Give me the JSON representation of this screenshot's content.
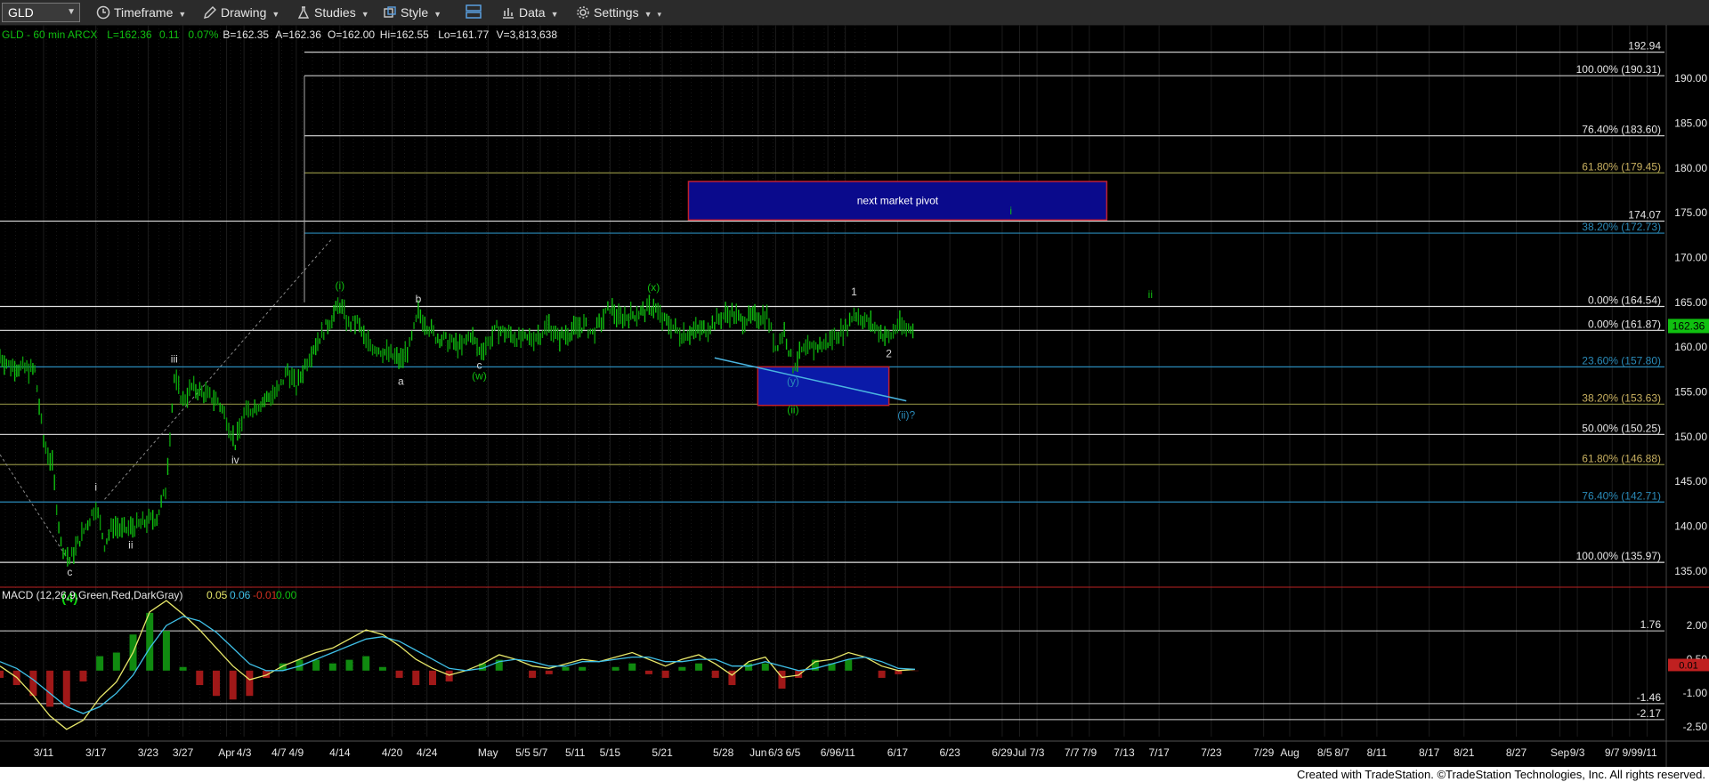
{
  "toolbar": {
    "symbol": "GLD",
    "timeframe": "Timeframe",
    "drawing": "Drawing",
    "studies": "Studies",
    "style": "Style",
    "data": "Data",
    "settings": "Settings"
  },
  "footer": "Created with TradeStation. ©TradeStation Technologies, Inc. All rights reserved.",
  "colors": {
    "bg": "#000000",
    "up": "#00c000",
    "down": "#c00000",
    "accent": "#2a8ab8",
    "pivot_box": "#0a0a8c"
  },
  "chart_data": [
    {
      "type": "line",
      "series_name": "GLD - 60 min ARCX",
      "header": {
        "symbol_line": "GLD - 60 min ARCX",
        "last": "L=162.36",
        "change": "0.11",
        "pct": "0.07%",
        "bid": "B=162.35",
        "ask": "A=162.36",
        "open": "O=162.00",
        "high": "Hi=162.55",
        "low": "Lo=161.77",
        "volume": "V=3,813,638"
      },
      "x_tick_labels": [
        "3/11",
        "3/17",
        "3/23",
        "3/27",
        "Apr",
        "4/3",
        "4/7",
        "4/9",
        "4/14",
        "4/20",
        "4/24",
        "May",
        "5/5",
        "5/7",
        "5/11",
        "5/15",
        "5/21",
        "5/28",
        "Jun",
        "6/3",
        "6/5",
        "6/9",
        "6/11",
        "6/17",
        "6/23",
        "6/29",
        "Jul",
        "7/3",
        "7/7",
        "7/9",
        "7/13",
        "7/17",
        "7/23",
        "7/29",
        "Aug",
        "8/5",
        "8/7",
        "8/11",
        "8/17",
        "8/21",
        "8/27",
        "Sep",
        "9/3",
        "9/7",
        "9/9",
        "9/11"
      ],
      "ylim": [
        133,
        193
      ],
      "y_ticks": [
        "135.00",
        "140.00",
        "145.00",
        "150.00",
        "155.00",
        "160.00",
        "165.00",
        "170.00",
        "175.00",
        "180.00",
        "185.00",
        "190.00"
      ],
      "last_price": "162.36",
      "price_points": [
        [
          "2025-03-06",
          159.0
        ],
        [
          "2025-03-07",
          158.0
        ],
        [
          "2025-03-10",
          157.4
        ],
        [
          "2025-03-11",
          149.5
        ],
        [
          "2025-03-12",
          146.8
        ],
        [
          "2025-03-13",
          138.0
        ],
        [
          "2025-03-14",
          136.2
        ],
        [
          "2025-03-17",
          142.3
        ],
        [
          "2025-03-18",
          138.0
        ],
        [
          "2025-03-19",
          140.2
        ],
        [
          "2025-03-20",
          139.5
        ],
        [
          "2025-03-21",
          139.8
        ],
        [
          "2025-03-24",
          141.0
        ],
        [
          "2025-03-25",
          144.0
        ],
        [
          "2025-03-26",
          156.5
        ],
        [
          "2025-03-27",
          154.0
        ],
        [
          "2025-03-28",
          155.5
        ],
        [
          "2025-03-31",
          154.0
        ],
        [
          "2025-04-01",
          152.0
        ],
        [
          "2025-04-02",
          149.2
        ],
        [
          "2025-04-03",
          152.5
        ],
        [
          "2025-04-04",
          153.2
        ],
        [
          "2025-04-07",
          155.2
        ],
        [
          "2025-04-08",
          157.5
        ],
        [
          "2025-04-09",
          155.5
        ],
        [
          "2025-04-10",
          158.0
        ],
        [
          "2025-04-11",
          160.0
        ],
        [
          "2025-04-14",
          164.8
        ],
        [
          "2025-04-15",
          162.5
        ],
        [
          "2025-04-16",
          162.8
        ],
        [
          "2025-04-17",
          160.5
        ],
        [
          "2025-04-18",
          160.0
        ],
        [
          "2025-04-21",
          158.5
        ],
        [
          "2025-04-22",
          160.0
        ],
        [
          "2025-04-23",
          163.8
        ],
        [
          "2025-04-24",
          162.5
        ],
        [
          "2025-04-25",
          161.2
        ],
        [
          "2025-04-28",
          160.0
        ],
        [
          "2025-04-29",
          161.5
        ],
        [
          "2025-04-30",
          159.5
        ],
        [
          "2025-05-01",
          160.5
        ],
        [
          "2025-05-02",
          162.0
        ],
        [
          "2025-05-05",
          160.8
        ],
        [
          "2025-05-06",
          161.0
        ],
        [
          "2025-05-07",
          161.5
        ],
        [
          "2025-05-08",
          162.5
        ],
        [
          "2025-05-09",
          161.0
        ],
        [
          "2025-05-12",
          162.5
        ],
        [
          "2025-05-13",
          161.5
        ],
        [
          "2025-05-14",
          162.8
        ],
        [
          "2025-05-15",
          164.5
        ],
        [
          "2025-05-16",
          163.2
        ],
        [
          "2025-05-19",
          164.0
        ],
        [
          "2025-05-20",
          164.6
        ],
        [
          "2025-05-21",
          163.0
        ],
        [
          "2025-05-22",
          162.5
        ],
        [
          "2025-05-23",
          161.5
        ],
        [
          "2025-05-26",
          162.0
        ],
        [
          "2025-05-27",
          162.8
        ],
        [
          "2025-05-28",
          163.5
        ],
        [
          "2025-05-29",
          163.8
        ],
        [
          "2025-05-30",
          163.0
        ],
        [
          "2025-06-02",
          163.6
        ],
        [
          "2025-06-03",
          160.0
        ],
        [
          "2025-06-04",
          161.8
        ],
        [
          "2025-06-05",
          157.8
        ],
        [
          "2025-06-06",
          159.5
        ],
        [
          "2025-06-09",
          160.5
        ],
        [
          "2025-06-10",
          161.5
        ],
        [
          "2025-06-11",
          162.0
        ],
        [
          "2025-06-12",
          163.8
        ],
        [
          "2025-06-13",
          163.2
        ],
        [
          "2025-06-16",
          161.0
        ],
        [
          "2025-06-17",
          162.5
        ],
        [
          "2025-06-18",
          162.0
        ],
        [
          "2025-06-19",
          162.36
        ]
      ],
      "horizontal_lines": [
        {
          "label": "192.94",
          "value": 192.94
        },
        {
          "label": "100.00% (190.31)",
          "value": 190.31
        },
        {
          "label": "76.40% (183.60)",
          "value": 183.6
        },
        {
          "label": "61.80% (179.45)",
          "value": 179.45
        },
        {
          "label": "174.07",
          "value": 174.07
        },
        {
          "label": "38.20% (172.73)",
          "value": 172.73
        },
        {
          "label": "0.00% (164.54)",
          "value": 164.54
        },
        {
          "label": "0.00% (161.87)",
          "value": 161.87
        },
        {
          "label": "23.60% (157.80)",
          "value": 157.8
        },
        {
          "label": "38.20% (153.63)",
          "value": 153.63
        },
        {
          "label": "50.00% (150.25)",
          "value": 150.25
        },
        {
          "label": "61.80% (146.88)",
          "value": 146.88
        },
        {
          "label": "76.40% (142.71)",
          "value": 142.71
        },
        {
          "label": "100.00% (135.97)",
          "value": 135.97
        }
      ],
      "pivot_box": {
        "label": "next market pivot",
        "from": "2025-05-24",
        "to": "2025-07-11",
        "high": 178.5,
        "low": 174.2
      },
      "target_box": {
        "from": "2025-06-03",
        "to": "2025-06-16",
        "high": 157.8,
        "low": 153.5
      },
      "wave_labels": [
        {
          "text": "c",
          "date": "2025-03-14",
          "value": 134.5
        },
        {
          "text": "(4)",
          "date": "2025-03-14",
          "value": 131.5
        },
        {
          "text": "i",
          "date": "2025-03-17",
          "value": 144.0
        },
        {
          "text": "ii",
          "date": "2025-03-21",
          "value": 137.5
        },
        {
          "text": "iii",
          "date": "2025-03-26",
          "value": 158.3
        },
        {
          "text": "iv",
          "date": "2025-04-02",
          "value": 147.0
        },
        {
          "text": "(i)",
          "date": "2025-04-14",
          "value": 166.5
        },
        {
          "text": "a",
          "date": "2025-04-21",
          "value": 155.8
        },
        {
          "text": "b",
          "date": "2025-04-23",
          "value": 165.0
        },
        {
          "text": "c",
          "date": "2025-04-30",
          "value": 157.6
        },
        {
          "text": "(w)",
          "date": "2025-04-30",
          "value": 156.4
        },
        {
          "text": "(x)",
          "date": "2025-05-20",
          "value": 166.3
        },
        {
          "text": "(y)",
          "date": "2025-06-05",
          "value": 155.8
        },
        {
          "text": "(ii)",
          "date": "2025-06-05",
          "value": 152.6
        },
        {
          "text": "1",
          "date": "2025-06-12",
          "value": 165.8
        },
        {
          "text": "2",
          "date": "2025-06-16",
          "value": 158.9
        },
        {
          "text": "(ii)?",
          "date": "2025-06-18",
          "value": 152.0
        },
        {
          "text": "i",
          "date": "2025-06-30",
          "value": 174.8
        },
        {
          "text": "ii",
          "date": "2025-07-16",
          "value": 165.5
        }
      ],
      "trend_lines": [
        {
          "from": [
            "2025-05-27",
            158.8
          ],
          "to": [
            "2025-06-18",
            154.0
          ]
        },
        {
          "from": [
            "2025-03-18",
            143.0
          ],
          "to": [
            "2025-04-13",
            172.0
          ]
        },
        {
          "from": [
            "2025-03-06",
            148.0
          ],
          "to": [
            "2025-03-14",
            136.0
          ]
        }
      ]
    },
    {
      "type": "line",
      "title": "MACD (12,26,9,Green,Red,DarkGray)",
      "values_legend": [
        "0.05",
        "0.06",
        "-0.01",
        "0.00"
      ],
      "ylim": [
        -3.2,
        3.5
      ],
      "y_ticks": [
        "2.00",
        "0.50",
        "-1.00",
        "-2.50"
      ],
      "levels": [
        {
          "label": "1.76",
          "value": 1.76
        },
        {
          "label": "-1.46",
          "value": -1.46
        },
        {
          "label": "-2.17",
          "value": -2.17
        }
      ],
      "last_value": "0.01",
      "series": [
        {
          "name": "MACD",
          "color": "#e8e86a",
          "values": [
            0.2,
            -0.3,
            -1.1,
            -2.0,
            -2.6,
            -2.2,
            -1.2,
            -0.5,
            0.8,
            2.6,
            3.1,
            2.5,
            1.8,
            1.0,
            0.2,
            -0.4,
            -0.2,
            0.2,
            0.5,
            0.8,
            1.0,
            1.4,
            1.8,
            1.6,
            1.1,
            0.5,
            0.1,
            -0.2,
            0.0,
            0.3,
            0.7,
            0.5,
            0.2,
            0.1,
            0.3,
            0.5,
            0.4,
            0.6,
            0.8,
            0.5,
            0.2,
            0.5,
            0.7,
            0.3,
            -0.2,
            0.4,
            0.6,
            -0.3,
            -0.2,
            0.4,
            0.5,
            0.8,
            0.6,
            0.2,
            0.0,
            0.05
          ]
        },
        {
          "name": "Signal",
          "color": "#3fc0e8",
          "values": [
            0.4,
            0.1,
            -0.4,
            -1.0,
            -1.6,
            -1.9,
            -1.6,
            -1.0,
            -0.2,
            1.0,
            2.0,
            2.4,
            2.2,
            1.7,
            1.0,
            0.3,
            0.0,
            0.0,
            0.2,
            0.5,
            0.8,
            1.1,
            1.4,
            1.5,
            1.3,
            0.9,
            0.5,
            0.1,
            0.0,
            0.1,
            0.4,
            0.5,
            0.4,
            0.2,
            0.2,
            0.4,
            0.4,
            0.5,
            0.6,
            0.6,
            0.4,
            0.4,
            0.5,
            0.5,
            0.2,
            0.2,
            0.4,
            0.2,
            0.0,
            0.1,
            0.3,
            0.5,
            0.6,
            0.4,
            0.1,
            0.06
          ]
        }
      ]
    }
  ]
}
